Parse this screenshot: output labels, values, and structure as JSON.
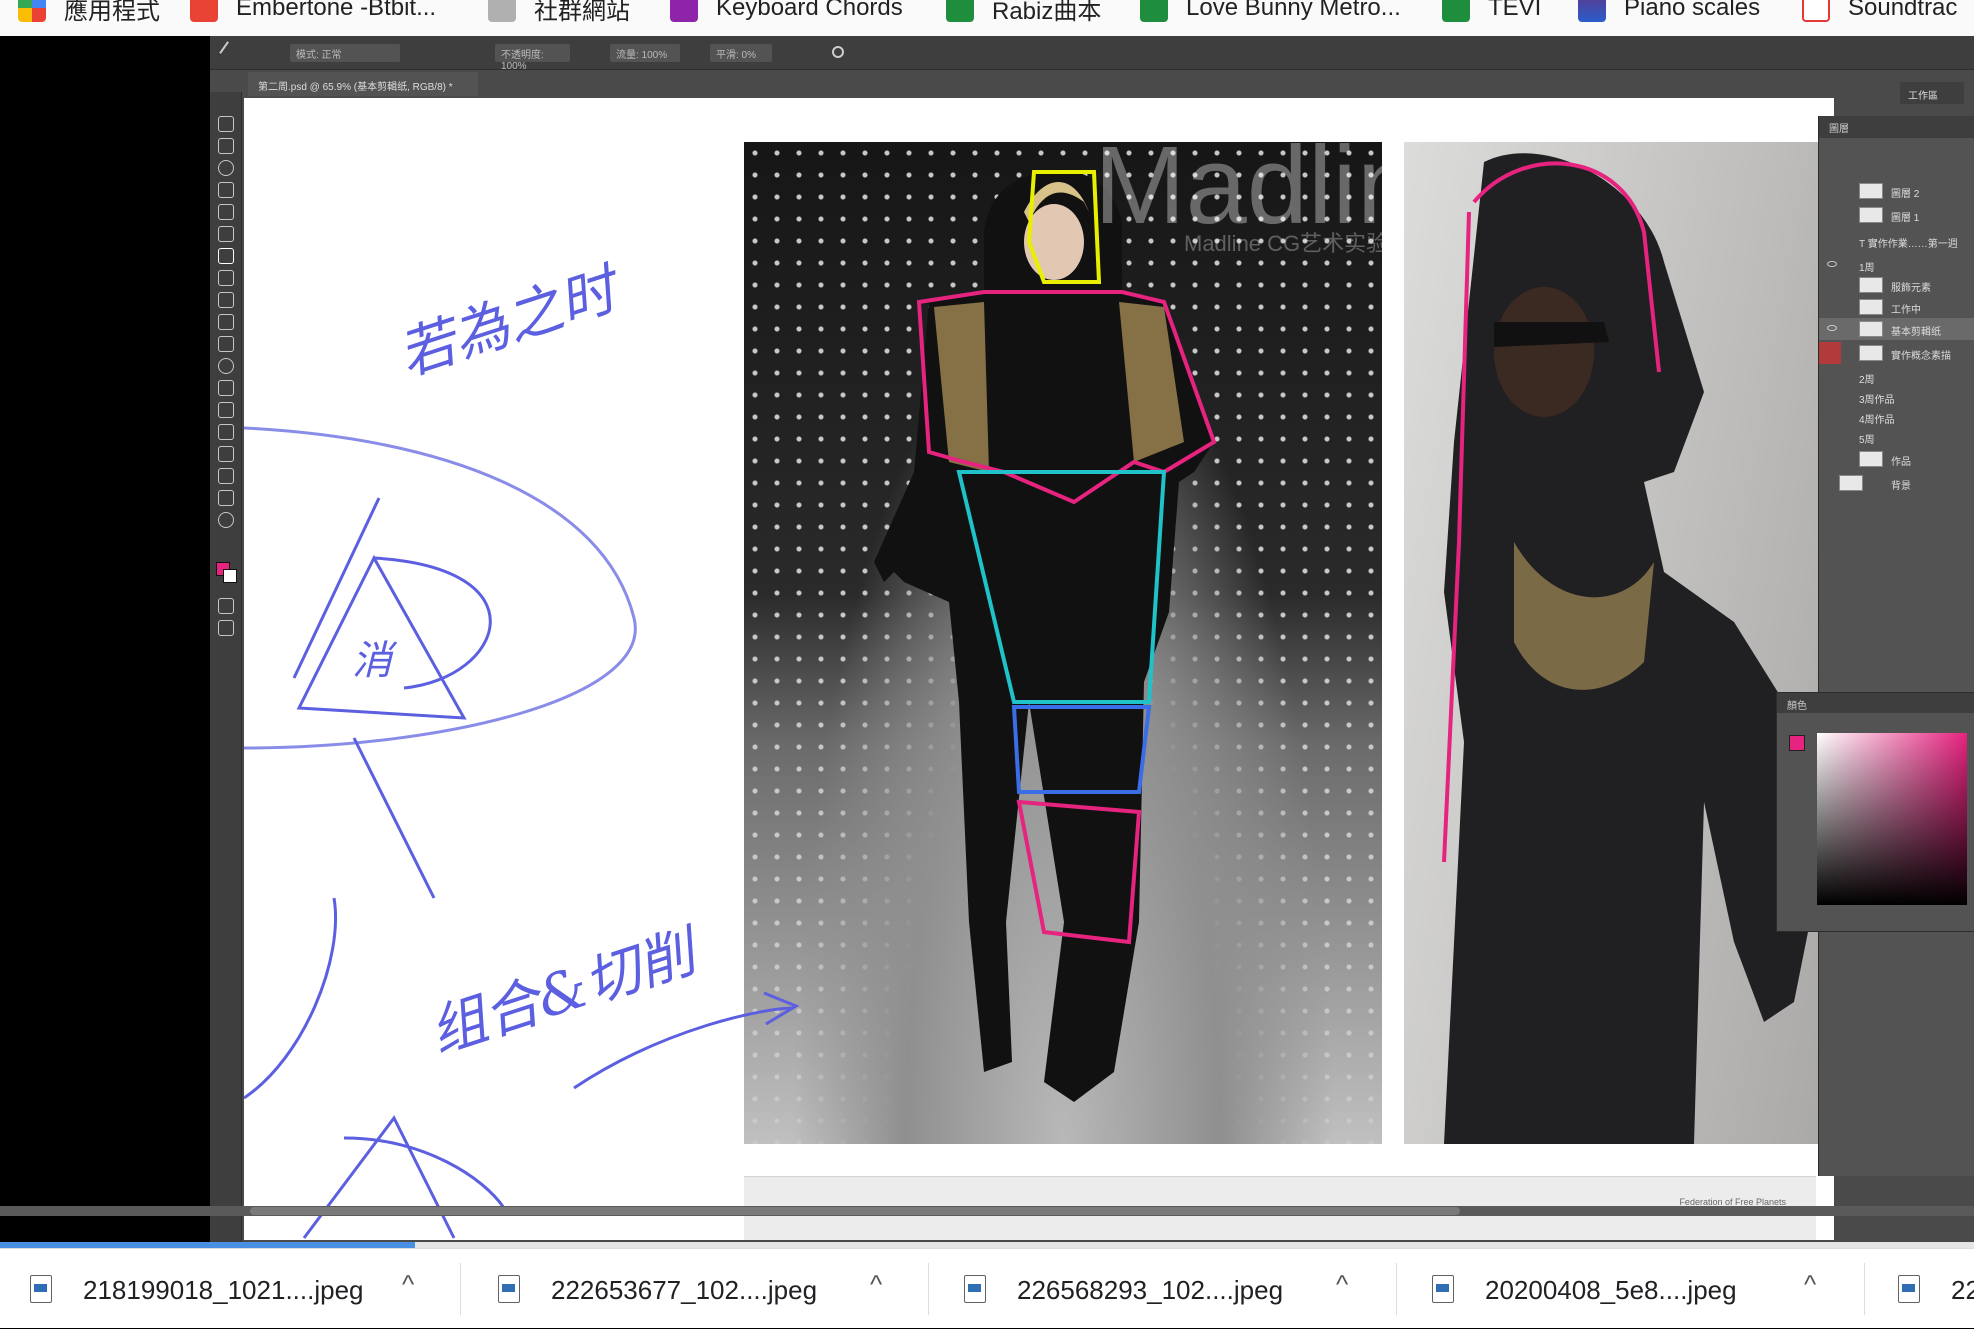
{
  "bookmarks": [
    {
      "label": "應用程式",
      "icon": "apps-grid-icon",
      "color": "#4285f4"
    },
    {
      "label": "Embertone -Btbit...",
      "icon": "bit-logo-icon",
      "color": "#e94335"
    },
    {
      "label": "社群網站",
      "icon": "folder-icon",
      "color": "#9e9e9e"
    },
    {
      "label": "Keyboard Chords",
      "icon": "tumblr-icon",
      "color": "#8e24aa"
    },
    {
      "label": "Rabiz曲本",
      "icon": "sheets-icon",
      "color": "#1e8e3e"
    },
    {
      "label": "Love Bunny Metro...",
      "icon": "sheets-icon",
      "color": "#1e8e3e"
    },
    {
      "label": "TEVI",
      "icon": "sheets-icon",
      "color": "#1e8e3e"
    },
    {
      "label": "Piano scales",
      "icon": "piano-image-icon",
      "color": "#5b3a8f"
    },
    {
      "label": "Soundtrac",
      "icon": "soc-logo-icon",
      "color": "#e53935"
    }
  ],
  "photoshop": {
    "doc_tab": "第二周.psd @ 65.9% (基本剪輯纸, RGB/8) *",
    "workspace": "工作區",
    "options": [
      "模式: 正常",
      "不透明度: 100%",
      "流量: 100%",
      "平滑: 0%"
    ],
    "layers_title": "圖層",
    "layers": [
      "圖層 2",
      "圖層 1",
      "T  實作作業……第一週",
      "1周",
      "服飾元素",
      "工作中",
      "基本剪輯纸",
      "實作概念素描",
      "2周",
      "3周作品",
      "4周作品",
      "5周",
      "作品",
      "背景"
    ],
    "color_panel_title": "顏色",
    "foreground_color": "#e6237f",
    "watermark": "Madline",
    "watermark_sub": "Madline CG艺术实验室",
    "credit": "Federation of Free Planets"
  },
  "annotations": {
    "top": "若為之时",
    "center": "消",
    "bottom": "组合&切削"
  },
  "download_progress": 0.21,
  "downloads": [
    {
      "name": "218199018_1021....jpeg"
    },
    {
      "name": "222653677_102....jpeg"
    },
    {
      "name": "226568293_102....jpeg"
    },
    {
      "name": "20200408_5e8....jpeg"
    },
    {
      "name": "22"
    }
  ]
}
